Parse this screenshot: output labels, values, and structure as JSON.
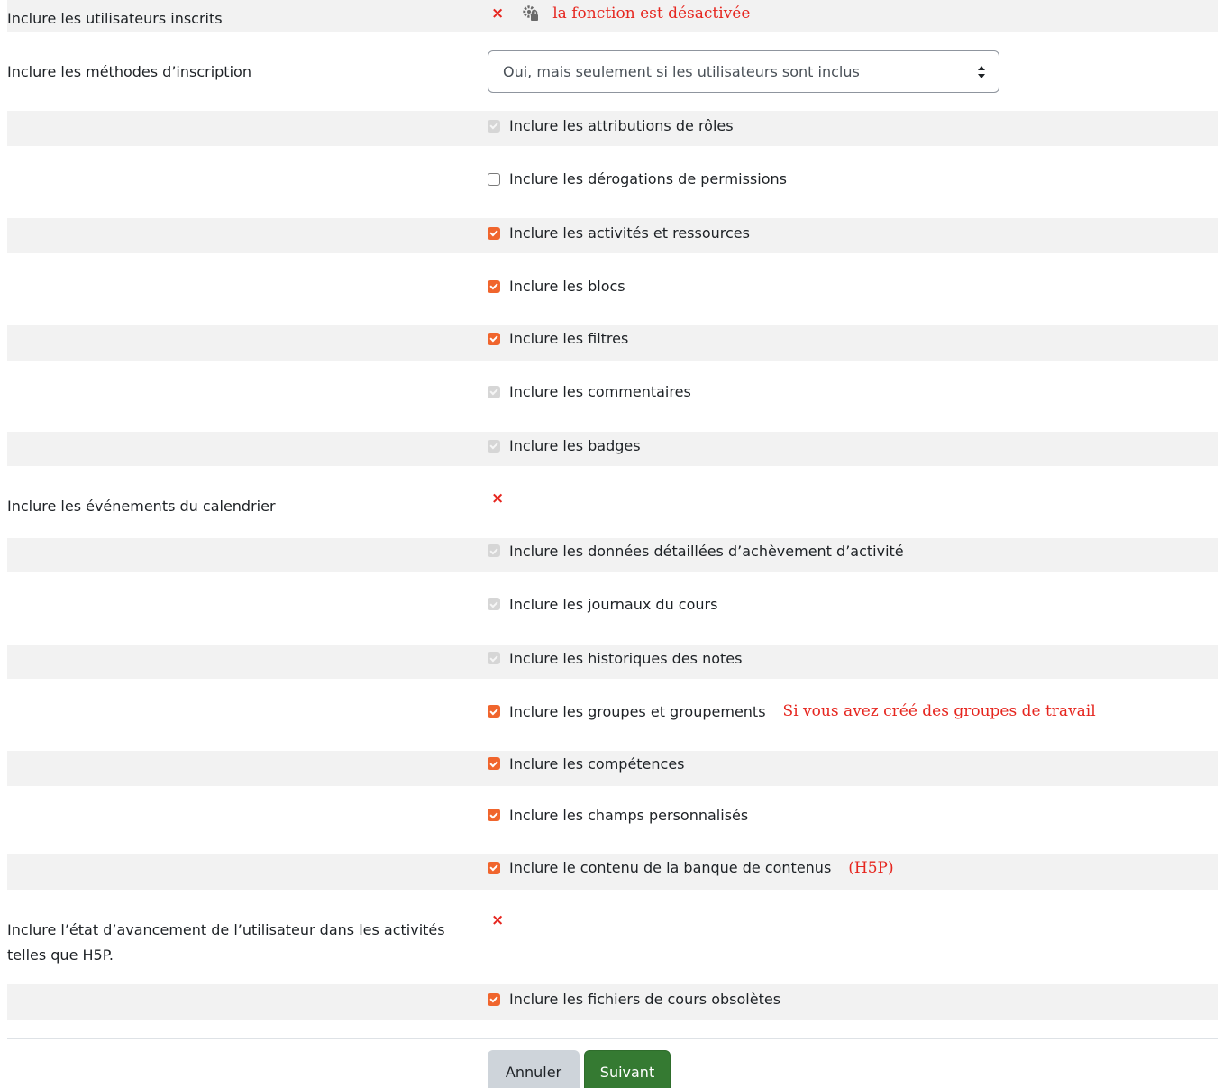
{
  "colors": {
    "accent_checkbox": "#f0652d",
    "annotation_red": "#e6261f",
    "stripe": "#f2f2f2",
    "next_button": "#357a32",
    "cancel_button": "#ced4da"
  },
  "rows": {
    "users": {
      "label": "Inclure les utilisateurs inscrits",
      "status_icon": "x-icon",
      "lock_icon": "gear-lock-icon",
      "note": "la fonction est désactivée"
    },
    "enrolment": {
      "label": "Inclure les méthodes d’inscription",
      "select_value": "Oui, mais seulement si les utilisateurs sont inclus"
    },
    "role_assignments": {
      "label": "Inclure les attributions de rôles",
      "state": "checked-disabled"
    },
    "permission_overrides": {
      "label": "Inclure les dérogations de permissions",
      "state": "unchecked"
    },
    "activities": {
      "label": "Inclure les activités et ressources",
      "state": "checked"
    },
    "blocks": {
      "label": "Inclure les blocs",
      "state": "checked"
    },
    "filters": {
      "label": "Inclure les filtres",
      "state": "checked"
    },
    "comments": {
      "label": "Inclure les commentaires",
      "state": "checked-disabled"
    },
    "badges": {
      "label": "Inclure les badges",
      "state": "checked-disabled"
    },
    "calendar": {
      "label": "Inclure les événements du calendrier",
      "status_icon": "x-icon"
    },
    "completion": {
      "label": "Inclure les données détaillées d’achèvement d’activité",
      "state": "checked-disabled"
    },
    "logs": {
      "label": "Inclure les journaux du cours",
      "state": "checked-disabled"
    },
    "grade_histories": {
      "label": "Inclure les historiques des notes",
      "state": "checked-disabled"
    },
    "groups": {
      "label": "Inclure les groupes et groupements",
      "state": "checked",
      "note": "Si vous avez créé des groupes de travail"
    },
    "competencies": {
      "label": "Inclure les compétences",
      "state": "checked"
    },
    "custom_fields": {
      "label": "Inclure les champs personnalisés",
      "state": "checked"
    },
    "content_bank": {
      "label": "Inclure le contenu de la banque de contenus",
      "state": "checked",
      "note": "(H5P)"
    },
    "user_progress": {
      "label_line1": "Inclure l’état d’avancement de l’utilisateur dans les activités",
      "label_line2": "telles que H5P.",
      "status_icon": "x-icon"
    },
    "legacy_files": {
      "label": "Inclure les fichiers de cours obsolètes",
      "state": "checked"
    }
  },
  "buttons": {
    "cancel": "Annuler",
    "next": "Suivant"
  },
  "symbols": {
    "x": "×"
  }
}
